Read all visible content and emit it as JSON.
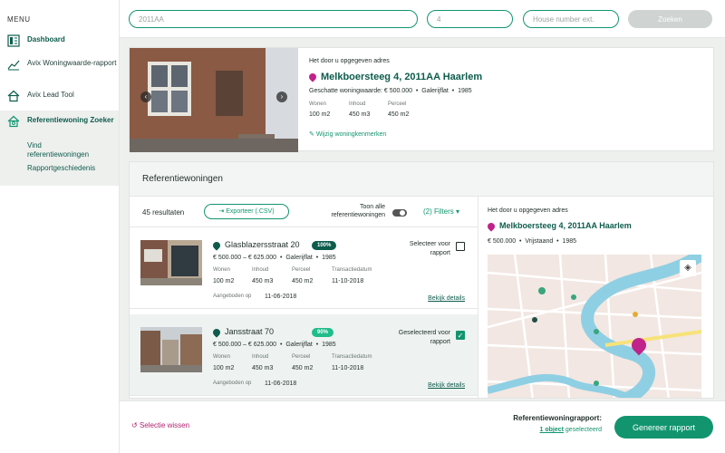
{
  "colors": {
    "accent": "#12956f",
    "dark_green": "#0d5c4c",
    "pin_magenta": "#c0238a",
    "badge_dark": "#0d5c4c",
    "badge_light": "#1fbd8a"
  },
  "sidebar": {
    "menu_title": "MENU",
    "items": [
      {
        "label": "Dashboard",
        "icon": "dashboard-icon"
      },
      {
        "label": "Avix Woningwaarde-rapport",
        "icon": "chart-house-icon"
      },
      {
        "label": "Avix Lead Tool",
        "icon": "house-icon"
      },
      {
        "label": "Referentiewoning Zoeker",
        "icon": "house-search-icon"
      }
    ],
    "subitems": [
      {
        "label": "Vind referentiewoningen"
      },
      {
        "label": "Rapportgeschiedenis"
      }
    ]
  },
  "search": {
    "postcode_value": "2011AA",
    "number_value": "4",
    "ext_placeholder": "House number ext.",
    "button_label": "Zoeken"
  },
  "address": {
    "caption": "Het door u opgegeven adres",
    "title": "Melkboersteeg 4, 2011AA Haarlem",
    "value_line": "Geschatte woningwaarde: € 500.000",
    "type": "Galerijflat",
    "year": "1985",
    "specs": [
      {
        "label": "Wonen",
        "value": "100 m2"
      },
      {
        "label": "Inhoud",
        "value": "450 m3"
      },
      {
        "label": "Perceel",
        "value": "450 m2"
      }
    ],
    "edit_link": "Wijzig woningkenmerken"
  },
  "references": {
    "section_title": "Referentiewoningen",
    "count": "45 resultaten",
    "export_label": "Exporteer (.CSV)",
    "toggle_label": "Toon alle referentiewoningen",
    "filters_label": "(2) Filters",
    "listings": [
      {
        "title": "Glasblazersstraat 20",
        "badge": "100%",
        "badge_color": "#0d5c4c",
        "price": "€ 500.000 – € 625.000",
        "type": "Galerijflat",
        "year": "1985",
        "specs": [
          {
            "label": "Wonen",
            "value": "100 m2"
          },
          {
            "label": "Inhoud",
            "value": "450 m3"
          },
          {
            "label": "Perceel",
            "value": "450 m2"
          },
          {
            "label": "Transactiedatum",
            "value": "11-10-2018"
          }
        ],
        "offered_label": "Aangeboden op",
        "offered_date": "11-06-2018",
        "select_label": "Selecteer voor rapport",
        "selected": false,
        "details_label": "Bekijk details"
      },
      {
        "title": "Jansstraat 70",
        "badge": "90%",
        "badge_color": "#1fbd8a",
        "price": "€ 500.000 – € 625.000",
        "type": "Galerijflat",
        "year": "1985",
        "specs": [
          {
            "label": "Wonen",
            "value": "100 m2"
          },
          {
            "label": "Inhoud",
            "value": "450 m3"
          },
          {
            "label": "Perceel",
            "value": "450 m2"
          },
          {
            "label": "Transactiedatum",
            "value": "11-10-2018"
          }
        ],
        "offered_label": "Aangeboden op",
        "offered_date": "11-06-2018",
        "select_label": "Geselecteerd voor rapport",
        "selected": true,
        "details_label": "Bekijk details"
      }
    ]
  },
  "detail_pane": {
    "caption": "Het door u opgegeven adres",
    "title": "Melkboersteeg 4, 2011AA Haarlem",
    "price": "€ 500.000",
    "type": "Vrijstaand",
    "year": "1985"
  },
  "footer": {
    "clear_label": "Selectie wissen",
    "report_label": "Referentiewoningrapport:",
    "count_strong": "1 object",
    "count_rest": " geselecteerd",
    "generate_label": "Genereer rapport"
  }
}
